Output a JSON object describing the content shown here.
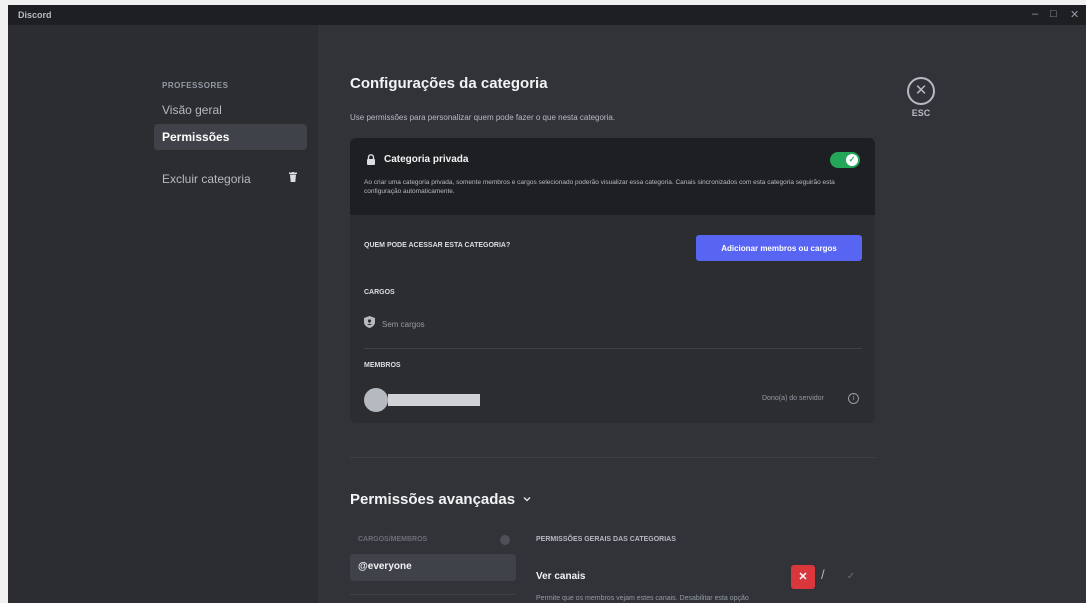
{
  "window": {
    "app_name": "Discord",
    "controls": [
      "–",
      "□",
      "✕"
    ]
  },
  "sidebar": {
    "header": "PROFESSORES",
    "items": [
      {
        "label": "Visão geral",
        "active": false
      },
      {
        "label": "Permissões",
        "active": true
      },
      {
        "label": "Excluir categoria",
        "active": false,
        "icon": "trash-icon"
      }
    ]
  },
  "close": {
    "label": "ESC",
    "icon": "close-icon"
  },
  "main": {
    "title": "Configurações da categoria",
    "subtitle": "Use permissões para personalizar quem pode fazer o que nesta categoria.",
    "private": {
      "title": "Categoria privada",
      "description": "Ao criar uma categoria privada, somente membros e cargos selecionado poderão visualizar essa categoria. Canais sincronizados com esta categoria seguirão esta configuração automaticamente.",
      "enabled": true,
      "toggle_color": "#23a55a"
    },
    "access": {
      "label": "QUEM PODE ACESSAR ESTA CATEGORIA?",
      "add_button": "Adicionar membros ou cargos",
      "button_color": "#5865f2"
    },
    "roles": {
      "label": "CARGOS",
      "empty": "Sem cargos"
    },
    "members": {
      "label": "MEMBROS",
      "owner_label": "Dono(a) do servidor"
    }
  },
  "advanced": {
    "title": "Permissões avançadas",
    "roles_header": "CARGOS/MEMBROS",
    "roles": [
      "@everyone"
    ],
    "permissions_header": "PERMISSÕES GERAIS DAS CATEGORIAS",
    "permissions": [
      {
        "name": "Ver canais",
        "description": "Permite que os membros vejam estes canais. Desabilitar esta opção",
        "state": "deny",
        "deny_glyph": "✕",
        "allow_glyph": "✓",
        "deny_color": "#da373c"
      }
    ]
  }
}
